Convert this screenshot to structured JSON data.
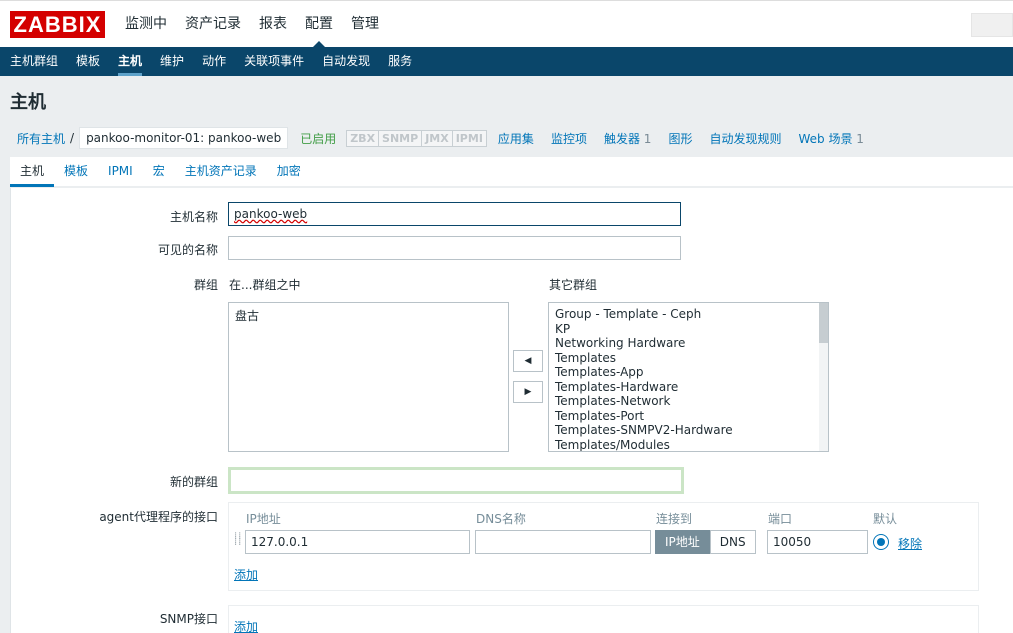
{
  "brand": {
    "logo": "ZABBIX"
  },
  "topnav": {
    "items": [
      "监测中",
      "资产记录",
      "报表",
      "配置",
      "管理"
    ],
    "active": "配置"
  },
  "subnav": {
    "items": [
      "主机群组",
      "模板",
      "主机",
      "维护",
      "动作",
      "关联项事件",
      "自动发现",
      "服务"
    ],
    "active": "主机"
  },
  "page": {
    "title": "主机"
  },
  "hostbar": {
    "all_hosts": "所有主机",
    "separator": "/",
    "current": "pankoo-monitor-01: pankoo-web",
    "status": "已启用",
    "availability": [
      "ZBX",
      "SNMP",
      "JMX",
      "IPMI"
    ],
    "links": [
      {
        "label": "应用集",
        "count": ""
      },
      {
        "label": "监控项",
        "count": ""
      },
      {
        "label": "触发器",
        "count": "1"
      },
      {
        "label": "图形",
        "count": ""
      },
      {
        "label": "自动发现规则",
        "count": ""
      },
      {
        "label": "Web 场景",
        "count": "1"
      }
    ]
  },
  "tabs": {
    "items": [
      "主机",
      "模板",
      "IPMI",
      "宏",
      "主机资产记录",
      "加密"
    ],
    "active": "主机"
  },
  "form": {
    "hostname_label": "主机名称",
    "hostname_value": "pankoo-web",
    "visible_name_label": "可见的名称",
    "visible_name_value": "",
    "groups_label": "群组",
    "in_groups_label": "在...群组之中",
    "other_groups_label": "其它群组",
    "in_groups": [
      "盘古"
    ],
    "other_groups": [
      "Group - Template - Ceph",
      "KP",
      "Networking Hardware",
      "Templates",
      "Templates-App",
      "Templates-Hardware",
      "Templates-Network",
      "Templates-Port",
      "Templates-SNMPV2-Hardware",
      "Templates/Modules"
    ],
    "arrow_left": "◀",
    "arrow_right": "▶",
    "new_group_label": "新的群组",
    "new_group_value": "",
    "agent_label": "agent代理程序的接口",
    "agent": {
      "col_ip": "IP地址",
      "col_dns": "DNS名称",
      "col_connect": "连接到",
      "col_port": "端口",
      "col_default": "默认",
      "ip_value": "127.0.0.1",
      "dns_value": "",
      "connect_options": [
        "IP地址",
        "DNS"
      ],
      "connect_selected": "IP地址",
      "port_value": "10050",
      "remove_label": "移除",
      "add_label": "添加"
    },
    "snmp_label": "SNMP接口",
    "snmp_add_label": "添加"
  }
}
